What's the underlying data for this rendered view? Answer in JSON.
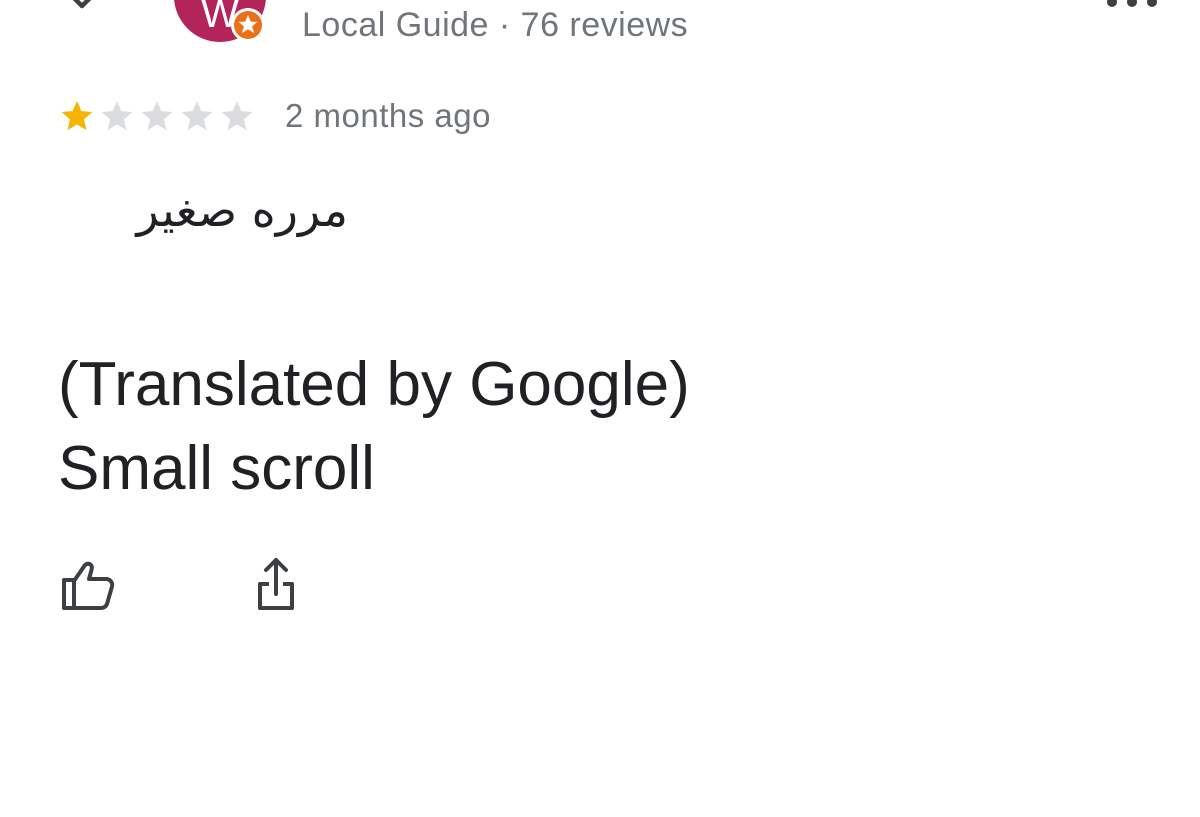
{
  "reviewer": {
    "avatar_letter": "W",
    "meta": "Local Guide · 76 reviews",
    "avatar_color": "#b3245a",
    "badge_color": "#e8711a",
    "icons": {
      "close": "close-icon",
      "badge": "local-guide-badge-icon",
      "more": "more-horizontal-icon"
    }
  },
  "review": {
    "rating": 1,
    "max_rating": 5,
    "star_filled_color": "#f4b400",
    "star_empty_color": "#dadce0",
    "timestamp": "2 months ago",
    "original_text": "مرره صغير",
    "translated_label": "(Translated by Google)",
    "translated_text": "Small scroll"
  },
  "actions": {
    "like_icon": "thumbs-up-icon",
    "share_icon": "share-icon"
  }
}
